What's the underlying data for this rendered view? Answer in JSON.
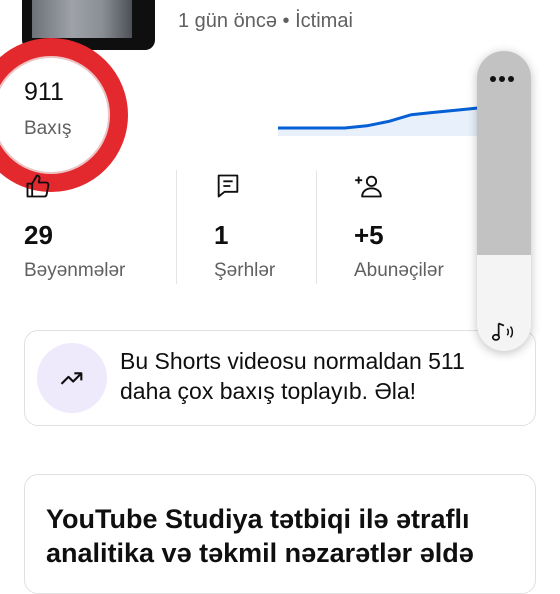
{
  "header": {
    "meta_time": "1 gün öncə",
    "meta_sep": "•",
    "meta_visibility": "İctimai"
  },
  "views": {
    "count": "911",
    "label": "Baxış"
  },
  "stats": [
    {
      "icon": "thumbs-up-icon",
      "value": "29",
      "label": "Bəyənmələr"
    },
    {
      "icon": "comment-icon",
      "value": "1",
      "label": "Şərhlər"
    },
    {
      "icon": "add-person-icon",
      "value": "+5",
      "label": "Abunəçilər"
    }
  ],
  "insight": {
    "icon": "trending-up-icon",
    "line1": "Bu Shorts videosu normaldan 511",
    "line2": "daha çox baxış toplayıb. Əla!"
  },
  "promo": {
    "line1": "YouTube Studiya tətbiqi ilə ətraflı",
    "line2": "analitika və təkmil nəzarətlər əldə"
  },
  "colors": {
    "accent_line": "#065fd4",
    "highlight_ring": "#e3282e",
    "trend_bg": "#efeafb"
  },
  "chart_data": {
    "type": "line",
    "series": [
      {
        "values": [
          2,
          2,
          2,
          2,
          3,
          5,
          8,
          9,
          10,
          11
        ]
      }
    ]
  }
}
